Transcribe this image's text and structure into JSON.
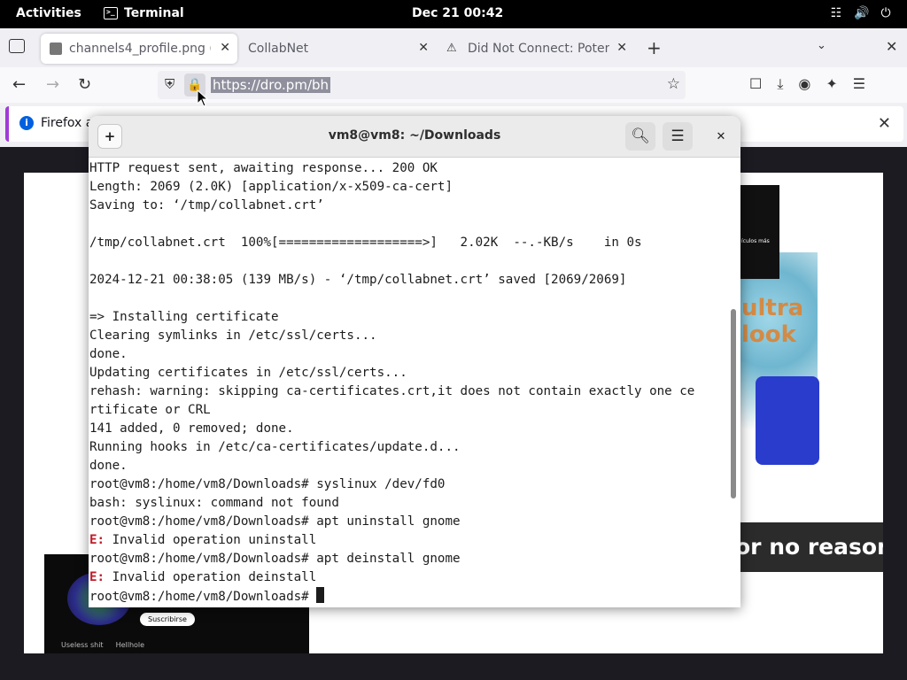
{
  "topbar": {
    "activities": "Activities",
    "app_name": "Terminal",
    "clock": "Dec 21  00:42",
    "tray_icons": [
      "network-icon",
      "volume-icon",
      "power-icon"
    ]
  },
  "browser": {
    "tabs": [
      {
        "label": "channels4_profile.png (P",
        "active": true
      },
      {
        "label": "CollabNet",
        "active": false
      },
      {
        "label": "Did Not Connect: Potenti",
        "active": false
      }
    ],
    "new_tab": "+",
    "url": "https://dro.pm/bh",
    "infobar_text": "Firefox a"
  },
  "page": {
    "img_caption": "ículos más",
    "figure_text": "ultra look",
    "banner": "or no reason",
    "subscribe": "Suscribirse",
    "links": [
      "Useless shit",
      "Hellhole"
    ]
  },
  "terminal": {
    "title": "vm8@vm8: ~/Downloads",
    "lines": [
      {
        "text": "HTTP request sent, awaiting response... 200 OK"
      },
      {
        "text": "Length: 2069 (2.0K) [application/x-x509-ca-cert]"
      },
      {
        "text": "Saving to: ‘/tmp/collabnet.crt’"
      },
      {
        "text": ""
      },
      {
        "text": "/tmp/collabnet.crt  100%[===================>]   2.02K  --.-KB/s    in 0s"
      },
      {
        "text": ""
      },
      {
        "text": "2024-12-21 00:38:05 (139 MB/s) - ‘/tmp/collabnet.crt’ saved [2069/2069]"
      },
      {
        "text": ""
      },
      {
        "text": "=> Installing certificate"
      },
      {
        "text": "Clearing symlinks in /etc/ssl/certs..."
      },
      {
        "text": "done."
      },
      {
        "text": "Updating certificates in /etc/ssl/certs..."
      },
      {
        "text": "rehash: warning: skipping ca-certificates.crt,it does not contain exactly one ce"
      },
      {
        "text": "rtificate or CRL"
      },
      {
        "text": "141 added, 0 removed; done."
      },
      {
        "text": "Running hooks in /etc/ca-certificates/update.d..."
      },
      {
        "text": "done."
      },
      {
        "text": "root@vm8:/home/vm8/Downloads# syslinux /dev/fd0"
      },
      {
        "text": "bash: syslinux: command not found"
      },
      {
        "text": "root@vm8:/home/vm8/Downloads# apt uninstall gnome"
      },
      {
        "err": "E:",
        "text": " Invalid operation uninstall"
      },
      {
        "text": "root@vm8:/home/vm8/Downloads# apt deinstall gnome"
      },
      {
        "err": "E:",
        "text": " Invalid operation deinstall"
      },
      {
        "text": "root@vm8:/home/vm8/Downloads# ",
        "cursor": true
      }
    ],
    "scroll_position": 0.58
  }
}
